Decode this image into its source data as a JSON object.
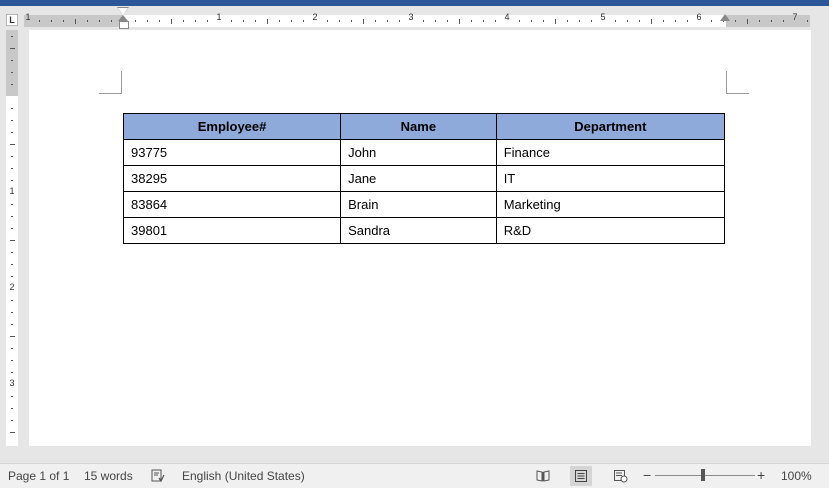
{
  "ruler": {
    "tab_selector": "L",
    "horizontal_numbers": [
      "1",
      "1",
      "2",
      "3",
      "4",
      "5",
      "6",
      "7"
    ],
    "vertical_numbers": [
      "1",
      "2",
      "3"
    ]
  },
  "table": {
    "headers": [
      "Employee#",
      "Name",
      "Department"
    ],
    "rows": [
      [
        "93775",
        "John",
        "Finance"
      ],
      [
        "38295",
        "Jane",
        "IT"
      ],
      [
        "83864",
        "Brain",
        "Marketing"
      ],
      [
        "39801",
        "Sandra",
        "R&D"
      ]
    ],
    "header_color": "#8eaadb"
  },
  "status": {
    "page": "Page 1 of 1",
    "words": "15 words",
    "language": "English (United States)",
    "zoom": "100%",
    "zoom_minus": "−",
    "zoom_plus": "+"
  },
  "icons": {
    "proofing": "proofing-book-icon",
    "read_mode": "read-mode-icon",
    "print_layout": "print-layout-icon",
    "web_layout": "web-layout-icon"
  },
  "colors": {
    "accent": "#2b579a",
    "page_bg": "#ffffff",
    "chrome_bg": "#e6e6e6"
  }
}
